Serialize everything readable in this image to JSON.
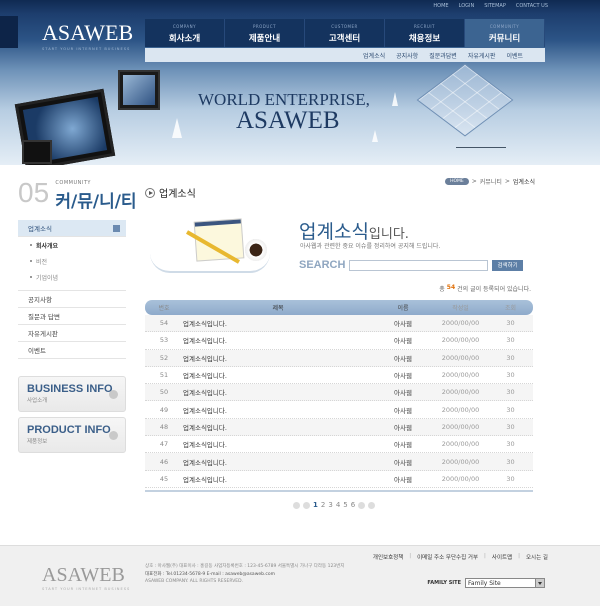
{
  "header": {
    "logo": "ASAWEB",
    "logo_tagline": "START YOUR INTERNET BUSINESS",
    "util_links": [
      "HOME",
      "LOGIN",
      "SITEMAP",
      "CONTACT US"
    ],
    "gnb": [
      {
        "en": "COMPANY",
        "ko": "회사소개"
      },
      {
        "en": "PRODUCT",
        "ko": "제품안내"
      },
      {
        "en": "CUSTOMER",
        "ko": "고객센터"
      },
      {
        "en": "RECRUIT",
        "ko": "채용정보"
      },
      {
        "en": "COMMUNITY",
        "ko": "커뮤니티"
      }
    ],
    "sub_gnb": [
      "업계소식",
      "공지사항",
      "질문과답변",
      "자유게시판",
      "이벤트"
    ],
    "hero_line1": "WORLD ENTERPRISE,",
    "hero_line2": "ASAWEB"
  },
  "sidebar": {
    "number": "05",
    "title_en": "COMMUNITY",
    "title_ko": "커/뮤/니/티",
    "active_item": "업계소식",
    "sub_items": [
      "회사개요",
      "비전",
      "기업이념"
    ],
    "items": [
      "공지사항",
      "질문과 답변",
      "자유게시판",
      "이벤트"
    ],
    "banners": [
      {
        "title": "BUSINESS INFO",
        "sub": "사업소개"
      },
      {
        "title": "PRODUCT INFO",
        "sub": "제품정보"
      }
    ]
  },
  "main": {
    "page_title": "업계소식",
    "breadcrumb": {
      "home": "HOME",
      "sep": ">",
      "parent": "커뮤니티",
      "current": "업계소식"
    },
    "intro_bold": "업계소식",
    "intro_suffix": "입니다.",
    "intro_desc": "아사웹과 관련한 중요 이슈를 정리하여 공지해 드립니다.",
    "search_label": "SEARCH",
    "search_value": "",
    "search_button": "검색하기",
    "count_prefix": "총",
    "count_value": "54",
    "count_suffix": "건의 글이 등록되어 있습니다.",
    "table": {
      "headers": [
        "번호",
        "제목",
        "이름",
        "작성일",
        "조회"
      ],
      "rows": [
        {
          "num": "54",
          "title": "업계소식입니다.",
          "name": "아사웹",
          "date": "2000/00/00",
          "views": "30"
        },
        {
          "num": "53",
          "title": "업계소식입니다.",
          "name": "아사웹",
          "date": "2000/00/00",
          "views": "30"
        },
        {
          "num": "52",
          "title": "업계소식입니다.",
          "name": "아사웹",
          "date": "2000/00/00",
          "views": "30"
        },
        {
          "num": "51",
          "title": "업계소식입니다.",
          "name": "아사웹",
          "date": "2000/00/00",
          "views": "30"
        },
        {
          "num": "50",
          "title": "업계소식입니다.",
          "name": "아사웹",
          "date": "2000/00/00",
          "views": "30"
        },
        {
          "num": "49",
          "title": "업계소식입니다.",
          "name": "아사웹",
          "date": "2000/00/00",
          "views": "30"
        },
        {
          "num": "48",
          "title": "업계소식입니다.",
          "name": "아사웹",
          "date": "2000/00/00",
          "views": "30"
        },
        {
          "num": "47",
          "title": "업계소식입니다.",
          "name": "아사웹",
          "date": "2000/00/00",
          "views": "30"
        },
        {
          "num": "46",
          "title": "업계소식입니다.",
          "name": "아사웹",
          "date": "2000/00/00",
          "views": "30"
        },
        {
          "num": "45",
          "title": "업계소식입니다.",
          "name": "아사웹",
          "date": "2000/00/00",
          "views": "30"
        }
      ]
    },
    "pager": {
      "pages": [
        "1",
        "2",
        "3",
        "4",
        "5",
        "6"
      ],
      "current": "1"
    }
  },
  "footer": {
    "links": [
      "개인보호정책",
      "이메일 주소 무단수집 거부",
      "사이트맵",
      "오시는 길"
    ],
    "logo": "ASAWEB",
    "logo_tagline": "START YOUR INTERNET BUSINESS",
    "info_line1": "상호 : 아사웹(주)  대표이사 : 홍길동  사업자등록번호 : 123-45-6789  서울특별시 가나구 다라동 123번지",
    "info_line2": "대표전화 : Tel.01234-5678-9  E-mail : asaweb@asaweb.com",
    "info_line3": "ASAWEB COMPANY. ALL RIGHTS RESERVED.",
    "family_label": "FAMILY SITE",
    "family_value": "Family Site"
  }
}
